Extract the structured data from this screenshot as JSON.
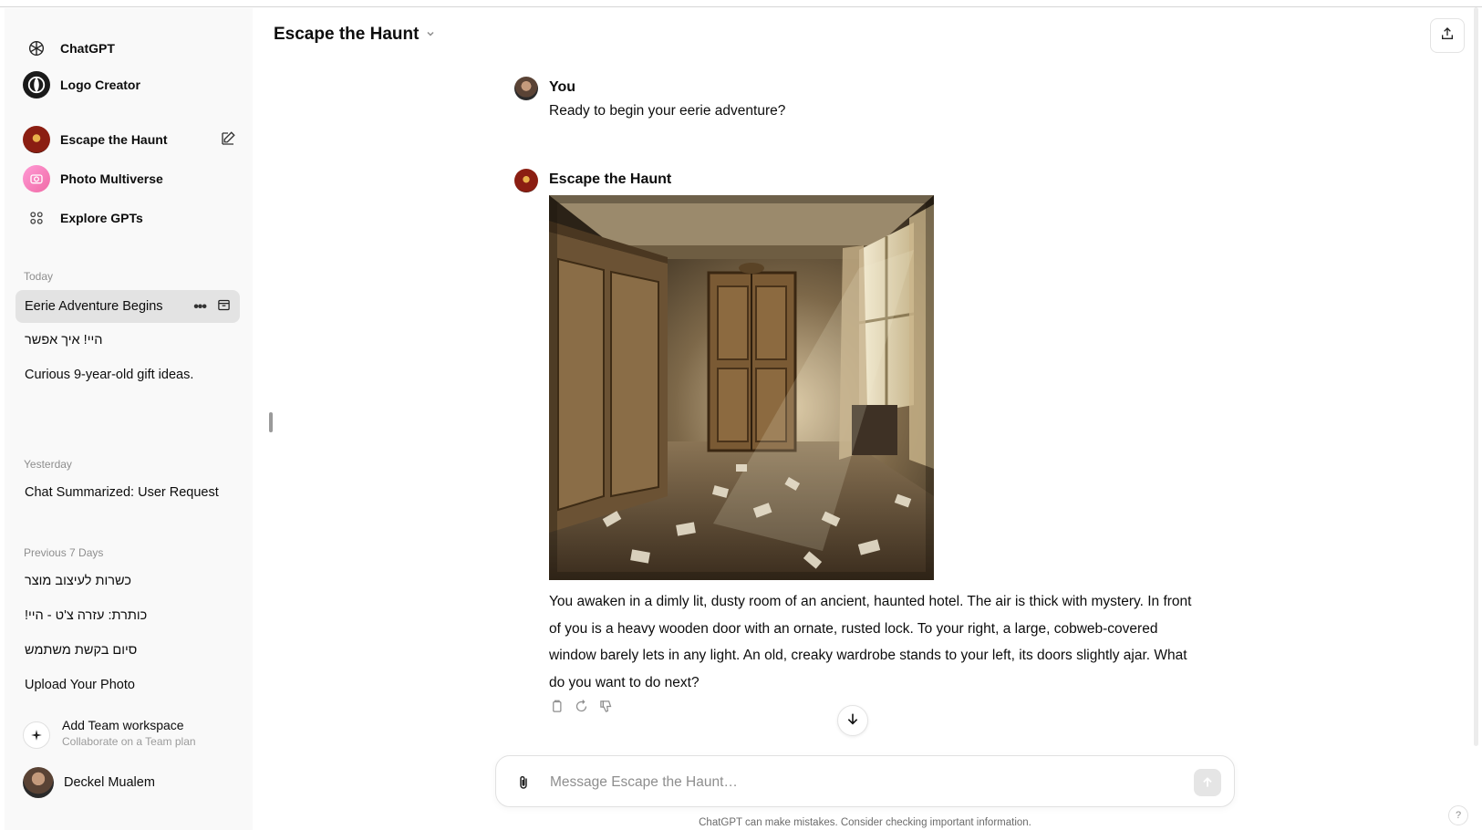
{
  "sidebar": {
    "gpts": [
      {
        "label": "ChatGPT",
        "icon": "openai-logo-icon"
      },
      {
        "label": "Logo Creator",
        "icon": "logo-creator-icon"
      },
      {
        "label": "Escape the Haunt",
        "icon": "escape-the-haunt-icon"
      },
      {
        "label": "Photo Multiverse",
        "icon": "photo-multiverse-icon"
      },
      {
        "label": "Explore GPTs",
        "icon": "grid-icon"
      }
    ],
    "sections": [
      {
        "label": "Today",
        "items": [
          {
            "label": "Eerie Adventure Begins",
            "active": true
          },
          {
            "label": "היי! איך אפשר"
          },
          {
            "label": "Curious 9-year-old gift ideas."
          }
        ]
      },
      {
        "label": "Yesterday",
        "items": [
          {
            "label": "Chat Summarized: User Request"
          }
        ]
      },
      {
        "label": "Previous 7 Days",
        "items": [
          {
            "label": "כשרות לעיצוב מוצר"
          },
          {
            "label": "כותרת: עזרה צ'ט - היי!"
          },
          {
            "label": "סיום בקשת משתמש"
          },
          {
            "label": "Upload Your Photo"
          }
        ]
      }
    ],
    "team": {
      "title": "Add Team workspace",
      "subtitle": "Collaborate on a Team plan"
    },
    "user": {
      "name": "Deckel Mualem"
    }
  },
  "header": {
    "title": "Escape the Haunt"
  },
  "conversation": {
    "user_message": {
      "author": "You",
      "text": "Ready to begin your eerie adventure?"
    },
    "assistant_message": {
      "author": "Escape the Haunt",
      "image_description": "haunted-room-image",
      "text": "You awaken in a dimly lit, dusty room of an ancient, haunted hotel. The air is thick with mystery. In front of you is a heavy wooden door with an ornate, rusted lock. To your right, a large, cobweb-covered window barely lets in any light. An old, creaky wardrobe stands to your left, its doors slightly ajar. What do you want to do next?"
    }
  },
  "composer": {
    "placeholder": "Message Escape the Haunt…"
  },
  "footer": {
    "disclaimer": "ChatGPT can make mistakes. Consider checking important information.",
    "help": "?"
  },
  "colors": {
    "sidebar_bg": "#f9f9f9",
    "active_item_bg": "#e3e3e3",
    "text": "#0d0d0d",
    "muted": "#8e8e8e"
  }
}
